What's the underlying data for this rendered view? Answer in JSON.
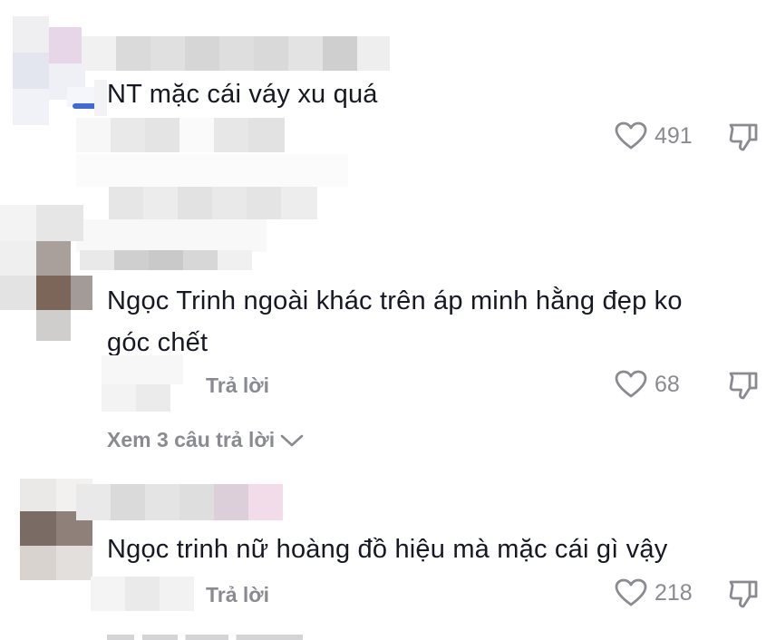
{
  "comments": [
    {
      "text": "NT mặc cái váy xu quá",
      "likes": "491"
    },
    {
      "text_line1": "Ngọc Trinh ngoài khác trên áp minh hằng đẹp ko",
      "text_line2": "góc chết",
      "reply_label": "Trả lời",
      "likes": "68",
      "view_replies": "Xem 3 câu trả lời"
    },
    {
      "text": "Ngọc trinh nữ hoàng đồ hiệu mà mặc cái gì vậy",
      "reply_label": "Trả lời",
      "likes": "218"
    }
  ],
  "colors": {
    "text": "#161823",
    "secondary": "#8a8b91",
    "icon": "#8a8b91"
  },
  "icons": {
    "like": "heart-outline-icon",
    "dislike": "thumbs-down-outline-icon",
    "expand": "chevron-down-icon"
  }
}
